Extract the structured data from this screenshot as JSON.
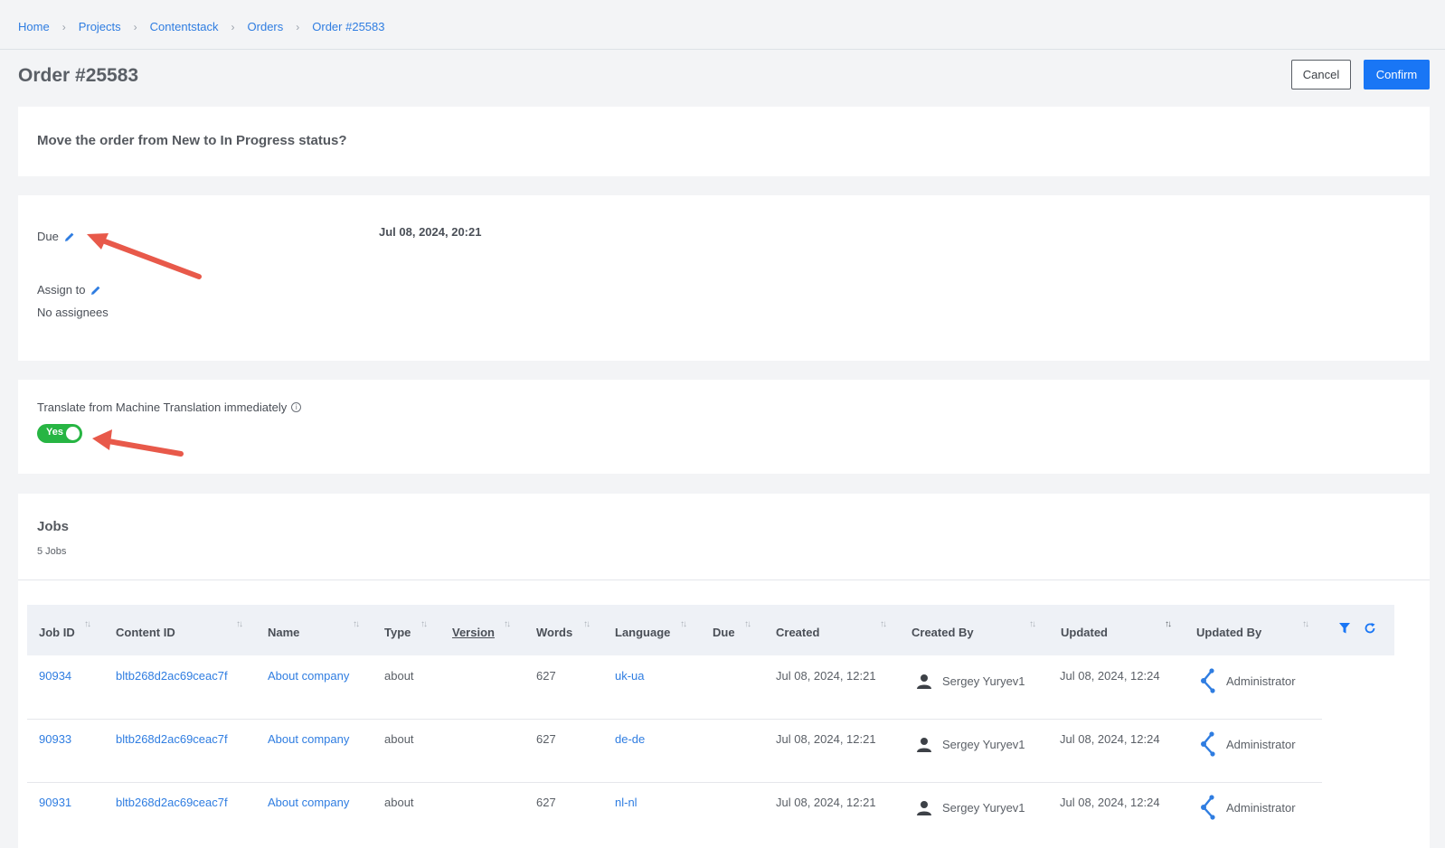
{
  "breadcrumb": [
    "Home",
    "Projects",
    "Contentstack",
    "Orders",
    "Order #25583"
  ],
  "page": {
    "title": "Order #25583",
    "cancel_label": "Cancel",
    "confirm_label": "Confirm"
  },
  "question": "Move the order from New to In Progress status?",
  "fields": {
    "due_label": "Due",
    "due_value": "Jul 08, 2024, 20:21",
    "assign_label": "Assign to",
    "assign_value": "No assignees"
  },
  "machine_translation": {
    "label": "Translate from Machine Translation immediately",
    "info_glyph": "i",
    "toggle_label": "Yes",
    "enabled": true
  },
  "jobs": {
    "title": "Jobs",
    "count": "5 Jobs",
    "columns": [
      "Job ID",
      "Content ID",
      "Name",
      "Type",
      "Version",
      "Words",
      "Language",
      "Due",
      "Created",
      "Created By",
      "Updated",
      "Updated By"
    ],
    "rows": [
      {
        "job_id": "90934",
        "content_id": "bltb268d2ac69ceac7f",
        "name": "About company",
        "type": "about",
        "version": "",
        "words": "627",
        "language": "uk-ua",
        "due": "",
        "created": "Jul 08, 2024, 12:21",
        "created_by": "Sergey Yuryev1",
        "updated": "Jul 08, 2024, 12:24",
        "updated_by": "Administrator"
      },
      {
        "job_id": "90933",
        "content_id": "bltb268d2ac69ceac7f",
        "name": "About company",
        "type": "about",
        "version": "",
        "words": "627",
        "language": "de-de",
        "due": "",
        "created": "Jul 08, 2024, 12:21",
        "created_by": "Sergey Yuryev1",
        "updated": "Jul 08, 2024, 12:24",
        "updated_by": "Administrator"
      },
      {
        "job_id": "90931",
        "content_id": "bltb268d2ac69ceac7f",
        "name": "About company",
        "type": "about",
        "version": "",
        "words": "627",
        "language": "nl-nl",
        "due": "",
        "created": "Jul 08, 2024, 12:21",
        "created_by": "Sergey Yuryev1",
        "updated": "Jul 08, 2024, 12:24",
        "updated_by": "Administrator"
      }
    ]
  },
  "colors": {
    "link": "#2f7de1",
    "primary": "#1976f5",
    "toggle_on": "#27b543",
    "annotation_arrow": "#e8594a"
  },
  "icons": [
    "pencil-icon",
    "info-icon",
    "sort-icon",
    "filter-icon",
    "refresh-icon",
    "user-icon",
    "admin-icon",
    "chevron-right-icon"
  ]
}
